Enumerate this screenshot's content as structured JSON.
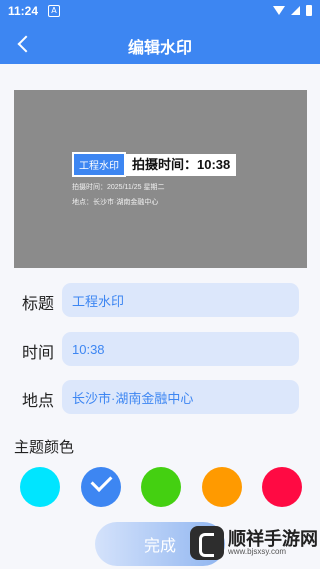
{
  "status": {
    "time": "11:24",
    "a_icon": "A"
  },
  "header": {
    "title": "编辑水印"
  },
  "preview": {
    "watermark_title": "工程水印",
    "time_text": "拍摄时间：10:38",
    "shoot_line": "拍摄时间：2025/11/25 星期二",
    "location_line": "地点：长沙市·湖南金融中心"
  },
  "form": {
    "title_label": "标题",
    "title_value": "工程水印",
    "time_label": "时间",
    "time_value": "10:38",
    "location_label": "地点",
    "location_value": "长沙市·湖南金融中心"
  },
  "theme": {
    "label": "主题颜色",
    "colors": [
      "#00e5ff",
      "#3d86f2",
      "#44d011",
      "#ff9a00",
      "#ff0a43"
    ],
    "selected_index": 1
  },
  "done_label": "完成",
  "brand": {
    "name": "顺祥手游网",
    "url": "www.bjsxsy.com"
  }
}
